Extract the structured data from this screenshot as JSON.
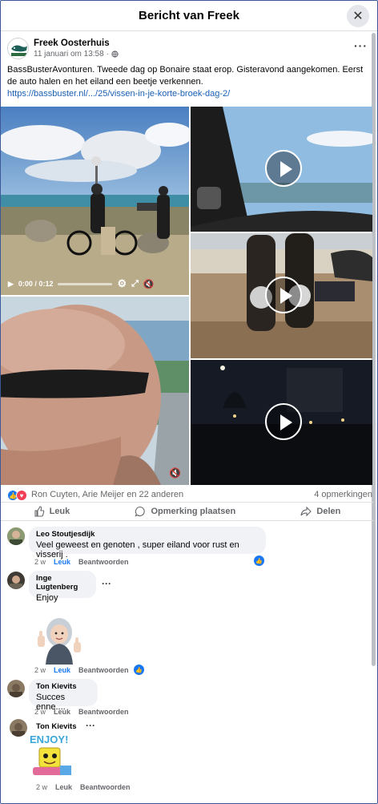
{
  "dialog": {
    "title": "Bericht van Freek"
  },
  "post": {
    "author": "Freek Oosterhuis",
    "page_logo_text": "BassBuster",
    "date": "11 januari om 13:58",
    "separator": "·",
    "text": "BassBusterAvonturen. Tweede dag op Bonaire staat erop. Gisteravond aangekomen. Eerst de auto halen en het eiland een beetje verkennen.",
    "link": "https://bassbuster.nl/.../25/vissen-in-je-korte-broek-dag-2/"
  },
  "video": {
    "time": "0:00 / 0:12"
  },
  "stats": {
    "names": "Ron Cuyten, Arie Meijer en 22 anderen",
    "comments": "4 opmerkingen"
  },
  "actions": {
    "like": "Leuk",
    "comment": "Opmerking plaatsen",
    "share": "Delen"
  },
  "comments": [
    {
      "name": "Leo Stoutjesdijk",
      "text": "Veel geweest en genoten , super eiland voor rust en visserij .",
      "time": "2 w",
      "like": "Leuk",
      "reply": "Beantwoorden"
    },
    {
      "name": "Inge Lugtenberg",
      "text": "Enjoy",
      "time": "2 w",
      "like": "Leuk",
      "reply": "Beantwoorden"
    },
    {
      "name": "Ton Kievits",
      "text": "Succes enne....",
      "time": "2 w",
      "like": "Leuk",
      "reply": "Beantwoorden"
    },
    {
      "name": "Ton Kievits",
      "sticker_text": "ENJOY!",
      "time": "2 w",
      "like": "Leuk",
      "reply": "Beantwoorden"
    }
  ],
  "colors": {
    "accent": "#1877f2",
    "link": "#1a5fb4",
    "bubble": "#f0f2f5"
  }
}
